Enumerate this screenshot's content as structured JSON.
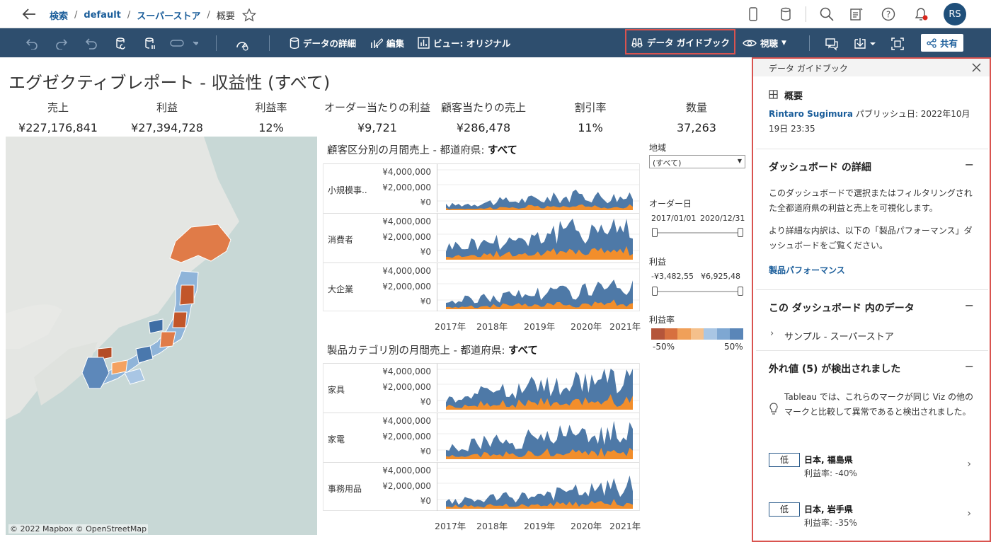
{
  "breadcrumb": {
    "search": "検索",
    "project": "default",
    "workbook": "スーパーストア",
    "view": "概要"
  },
  "user": {
    "initials": "RS"
  },
  "toolbar": {
    "data_details": "データの詳細",
    "edit": "編集",
    "view_original": "ビュー: オリジナル",
    "data_guide": "データ ガイドブック",
    "watch": "視聴",
    "share": "共有"
  },
  "dashboard": {
    "title": "エグゼクティブレポート - 収益性 (すべて)",
    "kpis": [
      {
        "label": "売上",
        "value": "¥227,176,841"
      },
      {
        "label": "利益",
        "value": "¥27,394,728"
      },
      {
        "label": "利益率",
        "value": "12%"
      },
      {
        "label": "オーダー当たりの利益",
        "value": "¥9,721"
      },
      {
        "label": "顧客当たりの売上",
        "value": "¥286,478"
      },
      {
        "label": "割引率",
        "value": "11%"
      },
      {
        "label": "数量",
        "value": "37,263"
      }
    ],
    "map_attribution": "© 2022 Mapbox © OpenStreetMap",
    "chart1_title_prefix": "顧客区分別の月間売上 - 都道府県: ",
    "chart1_title_bold": "すべて",
    "chart2_title_prefix": "製品カテゴリ別の月間売上 - 都道府県: ",
    "chart2_title_bold": "すべて",
    "y_ticks": [
      "¥4,000,000",
      "¥2,000,000",
      "¥0"
    ],
    "x_ticks": [
      "2017年",
      "2018年",
      "2019年",
      "2020年",
      "2021年"
    ],
    "chart1_segments": [
      "小規模事..",
      "消費者",
      "大企業"
    ],
    "chart2_segments": [
      "家具",
      "家電",
      "事務用品"
    ],
    "filters": {
      "region_label": "地域",
      "region_value": "(すべて)",
      "order_date_label": "オーダー日",
      "order_date_min": "2017/01/01",
      "order_date_max": "2020/12/31",
      "profit_label": "利益",
      "profit_min": "-¥3,482,55",
      "profit_max": "¥6,925,48",
      "margin_label": "利益率",
      "margin_min": "-50%",
      "margin_max": "50%"
    }
  },
  "chart_data": [
    {
      "type": "area",
      "title": "顧客区分別の月間売上 - 都道府県: すべて",
      "x": [
        "2017年",
        "2018年",
        "2019年",
        "2020年",
        "2021年"
      ],
      "ylim": [
        0,
        4000000
      ],
      "series": [
        {
          "name": "小規模事..",
          "values": [
            500000,
            900000,
            1200000,
            1600000,
            1300000
          ]
        },
        {
          "name": "消費者",
          "values": [
            1400000,
            2000000,
            2600000,
            3400000,
            3600000
          ]
        },
        {
          "name": "大企業",
          "values": [
            800000,
            1300000,
            1800000,
            2100000,
            2300000
          ]
        }
      ]
    },
    {
      "type": "area",
      "title": "製品カテゴリ別の月間売上 - 都道府県: すべて",
      "x": [
        "2017年",
        "2018年",
        "2019年",
        "2020年",
        "2021年"
      ],
      "ylim": [
        0,
        4000000
      ],
      "series": [
        {
          "name": "家具",
          "values": [
            1200000,
            2100000,
            2500000,
            3000000,
            3500000
          ]
        },
        {
          "name": "家電",
          "values": [
            1100000,
            1900000,
            2300000,
            2800000,
            3200000
          ]
        },
        {
          "name": "事務用品",
          "values": [
            700000,
            1100000,
            1500000,
            1900000,
            2500000
          ]
        }
      ]
    }
  ],
  "guide": {
    "header": "データ ガイドブック",
    "overview_title": "概要",
    "author": "Rintaro Sugimura",
    "published": " パブリッシュ日: 2022年10月19日 23:35",
    "details_title": "ダッシュボード の詳細",
    "details_p1": "このダッシュボードで選択またはフィルタリングされた全都道府県の利益と売上を可視化します。",
    "details_p2": "より詳細な内訳は、以下の「製品パフォーマンス」ダッシュボードをご覧ください。",
    "details_link": "製品パフォーマンス",
    "data_title": "この ダッシュボード 内のデータ",
    "data_source": "サンプル - スーパーストア",
    "outliers_title": "外れ値 (5) が検出されました",
    "outliers_text": "Tableau では、これらのマークが同じ Viz の他のマークと比較して異常であると検出されました。",
    "outliers": [
      {
        "tag": "低",
        "name": "日本, 福島県",
        "detail": "利益率: -40%"
      },
      {
        "tag": "低",
        "name": "日本, 岩手県",
        "detail": "利益率: -35%"
      }
    ]
  }
}
